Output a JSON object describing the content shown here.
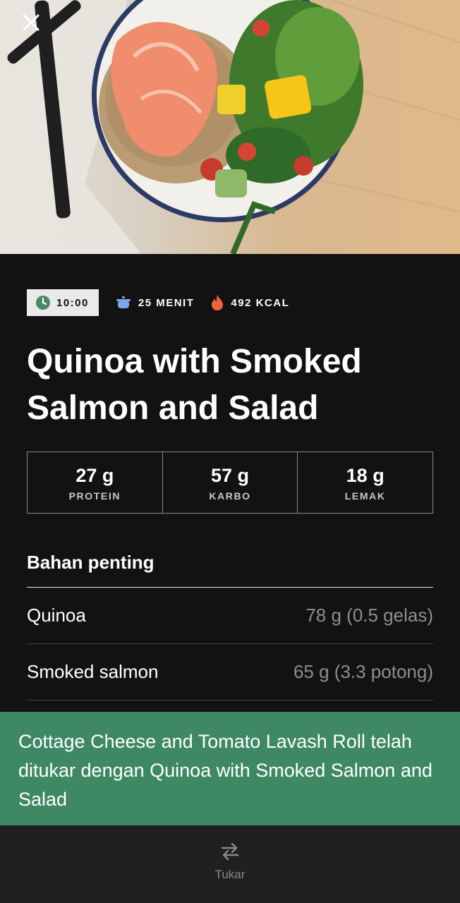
{
  "meal": {
    "time": "10:00",
    "duration": "25 MENIT",
    "calories": "492 KCAL",
    "title": "Quinoa with Smoked Salmon and Salad"
  },
  "macros": [
    {
      "value": "27 g",
      "label": "PROTEIN"
    },
    {
      "value": "57 g",
      "label": "KARBO"
    },
    {
      "value": "18 g",
      "label": "LEMAK"
    }
  ],
  "ingredients": {
    "title": "Bahan penting",
    "items": [
      {
        "name": "Quinoa",
        "amount": "78 g (0.5 gelas)"
      },
      {
        "name": "Smoked salmon",
        "amount": "65 g (3.3 potong)"
      }
    ]
  },
  "toast": {
    "message": "Cottage Cheese and Tomato Lavash Roll telah ditukar dengan Quinoa with Smoked Salmon and Salad"
  },
  "bottom_bar": {
    "swap_label": "Tukar"
  },
  "icons": {
    "close": "close-icon",
    "clock": "clock-icon",
    "pot": "pot-icon",
    "flame": "flame-icon",
    "swap": "swap-icon"
  },
  "colors": {
    "toast_bg": "#3f8864",
    "clock_green": "#4a8a68",
    "pot_blue": "#7aa7e6",
    "flame_orange": "#f0623a"
  }
}
